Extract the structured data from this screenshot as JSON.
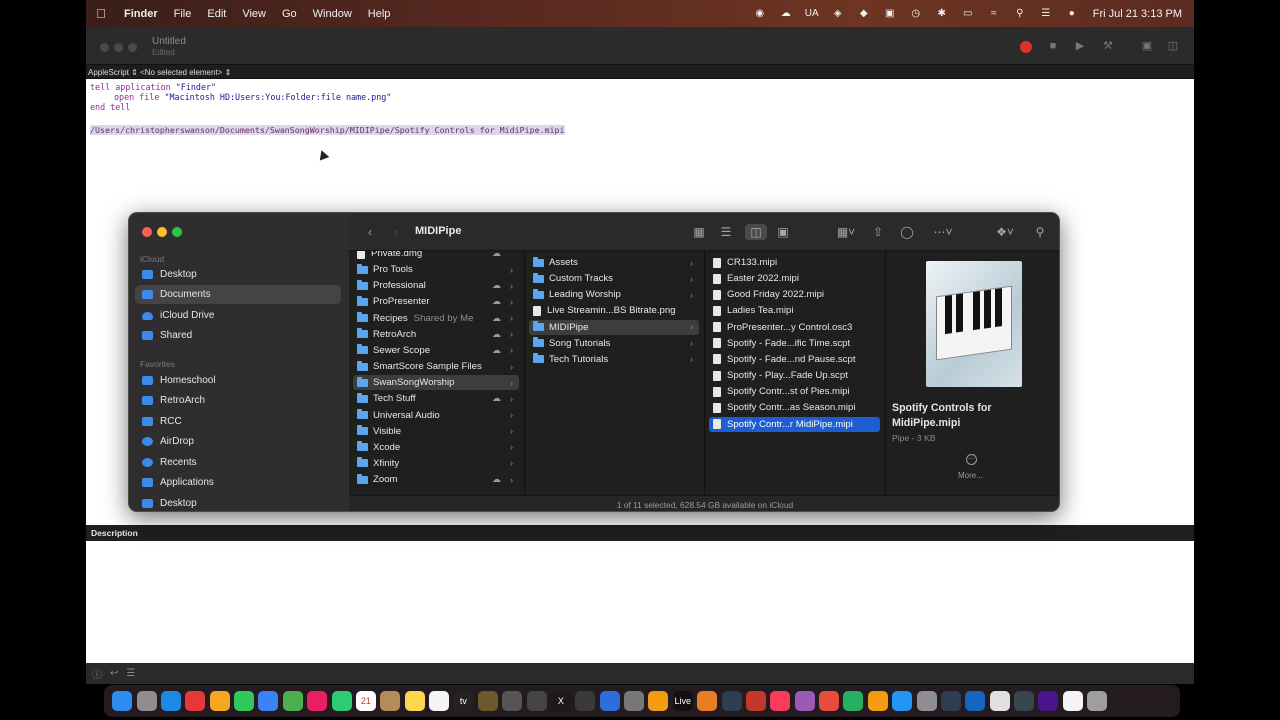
{
  "menubar": {
    "app": "Finder",
    "items": [
      "File",
      "Edit",
      "View",
      "Go",
      "Window",
      "Help"
    ],
    "status_icons": [
      "record-icon",
      "cloud-icon",
      "keyboard-layout-icon",
      "network-icon",
      "screens-icon",
      "input-icon",
      "clock-icon",
      "bluetooth-icon",
      "battery-icon",
      "wifi-icon",
      "search-icon",
      "control-center-icon",
      "siri-icon"
    ],
    "keyboard_layout": "UA",
    "clock": "Fri Jul 21  3:13 PM"
  },
  "editor": {
    "title": "Untitled",
    "subtitle": "Edited",
    "nav_language": "AppleScript",
    "nav_element": "<No selected element>",
    "code": {
      "line1_kw": "tell application",
      "line1_str": "\"Finder\"",
      "line2_kw": "open file",
      "line2_str": "\"Macintosh HD:Users:You:Folder:file name.png\"",
      "line3_kw": "end tell"
    },
    "result": "/Users/christopherswanson/Documents/SwanSongWorship/MIDIPipe/Spotify Controls for MidiPipe.mipi",
    "description_label": "Description"
  },
  "finder": {
    "title": "MIDIPipe",
    "sidebar": {
      "icloud_heading": "iCloud",
      "icloud_items": [
        {
          "label": "Desktop",
          "icon": "desktop-icon"
        },
        {
          "label": "Documents",
          "icon": "document-icon",
          "selected": true
        },
        {
          "label": "iCloud Drive",
          "icon": "cloud-icon"
        },
        {
          "label": "Shared",
          "icon": "shared-folder-icon"
        }
      ],
      "favorites_heading": "Favorites",
      "favorite_items": [
        {
          "label": "Homeschool",
          "icon": "folder-icon"
        },
        {
          "label": "RetroArch",
          "icon": "folder-icon"
        },
        {
          "label": "RCC",
          "icon": "folder-icon"
        },
        {
          "label": "AirDrop",
          "icon": "airdrop-icon"
        },
        {
          "label": "Recents",
          "icon": "clock-icon"
        },
        {
          "label": "Applications",
          "icon": "applications-icon"
        },
        {
          "label": "Desktop",
          "icon": "desktop-icon"
        }
      ]
    },
    "col1": [
      {
        "label": "Private.dmg",
        "type": "file",
        "cloud": true
      },
      {
        "label": "Pro Tools",
        "type": "folder",
        "chev": true
      },
      {
        "label": "Professional",
        "type": "folder",
        "cloud": true,
        "chev": true
      },
      {
        "label": "ProPresenter",
        "type": "folder",
        "cloud": true,
        "chev": true
      },
      {
        "label": "Recipes",
        "type": "folder",
        "tag": "Shared by Me",
        "cloud": true,
        "chev": true
      },
      {
        "label": "RetroArch",
        "type": "folder",
        "cloud": true,
        "chev": true
      },
      {
        "label": "Sewer Scope",
        "type": "folder",
        "cloud": true,
        "chev": true
      },
      {
        "label": "SmartScore Sample Files",
        "type": "folder",
        "chev": true
      },
      {
        "label": "SwanSongWorship",
        "type": "folder",
        "chev": true,
        "highlight": true
      },
      {
        "label": "Tech Stuff",
        "type": "folder",
        "cloud": true,
        "chev": true
      },
      {
        "label": "Universal Audio",
        "type": "folder",
        "chev": true
      },
      {
        "label": "Visible",
        "type": "folder",
        "chev": true
      },
      {
        "label": "Xcode",
        "type": "folder",
        "chev": true
      },
      {
        "label": "Xfinity",
        "type": "folder",
        "chev": true
      },
      {
        "label": "Zoom",
        "type": "folder",
        "cloud": true,
        "chev": true
      }
    ],
    "col2": [
      {
        "label": "Assets",
        "type": "folder",
        "chev": true
      },
      {
        "label": "Custom Tracks",
        "type": "folder",
        "chev": true
      },
      {
        "label": "Leading Worship",
        "type": "folder",
        "chev": true
      },
      {
        "label": "Live Streamin...BS Bitrate.png",
        "type": "file"
      },
      {
        "label": "MIDIPipe",
        "type": "folder",
        "chev": true,
        "highlight": true
      },
      {
        "label": "Song Tutorials",
        "type": "folder",
        "chev": true
      },
      {
        "label": "Tech Tutorials",
        "type": "folder",
        "chev": true
      }
    ],
    "col3": [
      {
        "label": "CR133.mipi",
        "type": "file"
      },
      {
        "label": "Easter 2022.mipi",
        "type": "file"
      },
      {
        "label": "Good Friday 2022.mipi",
        "type": "file"
      },
      {
        "label": "Ladies Tea.mipi",
        "type": "file"
      },
      {
        "label": "ProPresenter...y Control.osc3",
        "type": "file"
      },
      {
        "label": "Spotify - Fade...ific Time.scpt",
        "type": "file"
      },
      {
        "label": "Spotify - Fade...nd Pause.scpt",
        "type": "file"
      },
      {
        "label": "Spotify - Play...Fade Up.scpt",
        "type": "file"
      },
      {
        "label": "Spotify Contr...st of Pies.mipi",
        "type": "file"
      },
      {
        "label": "Spotify Contr...as Season.mipi",
        "type": "file"
      },
      {
        "label": "Spotify Contr...r MidiPipe.mipi",
        "type": "file",
        "selected": true
      }
    ],
    "preview": {
      "name": "Spotify Controls for MidiPipe.mipi",
      "kind": "Pipe - 3 KB",
      "more": "More..."
    },
    "status": "1 of 11 selected, 628.54 GB available on iCloud"
  },
  "dock": {
    "apps": [
      {
        "name": "finder-icon",
        "color": "#2d8cf0"
      },
      {
        "name": "launchpad-icon",
        "color": "#8e8e8e"
      },
      {
        "name": "safari-icon",
        "color": "#1e88e5"
      },
      {
        "name": "chrome-icon",
        "color": "#e53935"
      },
      {
        "name": "photos-icon",
        "color": "#f5a623"
      },
      {
        "name": "messages-icon",
        "color": "#34c759"
      },
      {
        "name": "mail-icon",
        "color": "#3b82f6"
      },
      {
        "name": "maps-icon",
        "color": "#4caf50"
      },
      {
        "name": "photos-app-icon",
        "color": "#e91e63"
      },
      {
        "name": "facetime-icon",
        "color": "#2ecc71"
      },
      {
        "name": "calendar-icon",
        "color": "#ffffff",
        "text": "21"
      },
      {
        "name": "contacts-icon",
        "color": "#b58b5a"
      },
      {
        "name": "notes-icon",
        "color": "#ffd54f"
      },
      {
        "name": "reminders-icon",
        "color": "#f5f5f5"
      },
      {
        "name": "apple-tv-icon",
        "color": "#222222",
        "text": "tv"
      },
      {
        "name": "midi-app-icon",
        "color": "#6d5a2c"
      },
      {
        "name": "mixer-icon",
        "color": "#555555"
      },
      {
        "name": "xcode-edit-icon",
        "color": "#444444"
      },
      {
        "name": "x-icon",
        "color": "#1a1a1a",
        "text": "X"
      },
      {
        "name": "tools-icon",
        "color": "#3a3a3a"
      },
      {
        "name": "piano-icon",
        "color": "#2a6fdb"
      },
      {
        "name": "settings-icon",
        "color": "#777777"
      },
      {
        "name": "plugin-icon",
        "color": "#f39c12"
      },
      {
        "name": "live-icon",
        "color": "#111111",
        "text": "Live"
      },
      {
        "name": "office-icon",
        "color": "#e67e22"
      },
      {
        "name": "prompter-icon",
        "color": "#2c3e50"
      },
      {
        "name": "play-icon",
        "color": "#c0392b"
      },
      {
        "name": "music-icon",
        "color": "#fa3c5a"
      },
      {
        "name": "podcasts-icon",
        "color": "#9b59b6"
      },
      {
        "name": "news-icon",
        "color": "#e74c3c"
      },
      {
        "name": "numbers-icon",
        "color": "#27ae60"
      },
      {
        "name": "pages-icon",
        "color": "#f39c12"
      },
      {
        "name": "app-store-icon",
        "color": "#2196f3"
      },
      {
        "name": "system-settings-icon",
        "color": "#8e8e93"
      },
      {
        "name": "steering-icon",
        "color": "#2c3e50"
      },
      {
        "name": "browser-icon",
        "color": "#1565c0"
      },
      {
        "name": "script-editor-icon",
        "color": "#e0e0e0"
      },
      {
        "name": "camera-icon",
        "color": "#37474f"
      },
      {
        "name": "final-cut-icon",
        "color": "#4a148c"
      },
      {
        "name": "document-icon",
        "color": "#f5f5f5"
      },
      {
        "name": "trash-icon",
        "color": "#9e9e9e"
      }
    ]
  }
}
